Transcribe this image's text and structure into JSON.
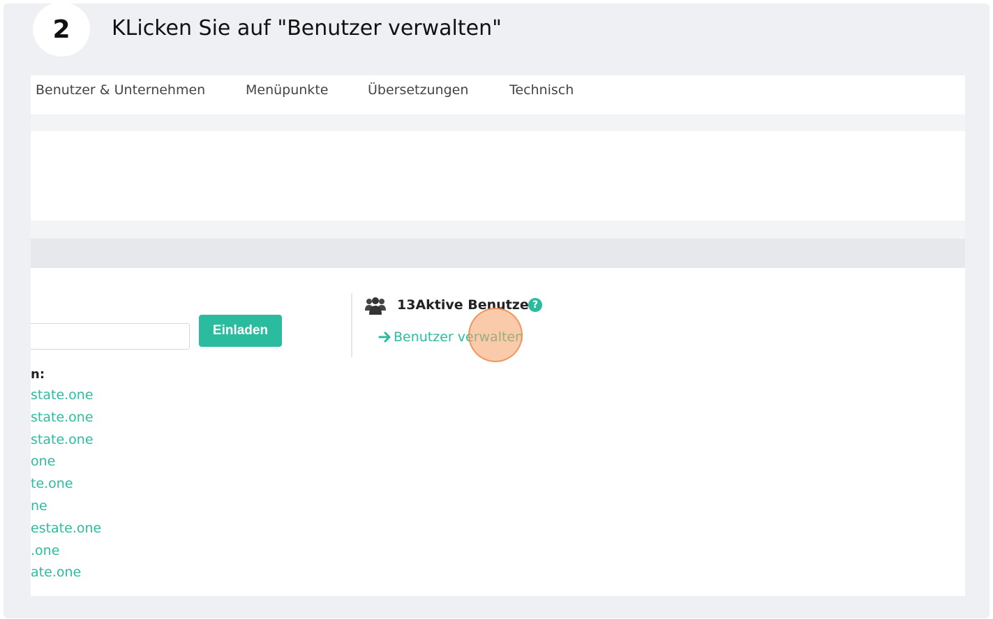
{
  "guide": {
    "step_number": "2",
    "step_title": "KLicken Sie auf \"Benutzer verwalten\""
  },
  "nav": {
    "items": [
      "Benutzer & Unternehmen",
      "Menüpunkte",
      "Übersetzungen",
      "Technisch"
    ]
  },
  "invite": {
    "input_value": "ı",
    "button_label": "Einladen"
  },
  "pending": {
    "label": "n:",
    "emails": [
      "state.one",
      "state.one",
      "state.one",
      "one",
      "te.one",
      "ne",
      "estate.one",
      ".one",
      "ate.one"
    ]
  },
  "users": {
    "icon": "users-icon",
    "active_label": "13Aktive Benutzer",
    "help_icon": "?",
    "manage_link": "Benutzer verwalten"
  },
  "colors": {
    "accent": "#2bbc9f",
    "click_marker": "#f5a064"
  }
}
